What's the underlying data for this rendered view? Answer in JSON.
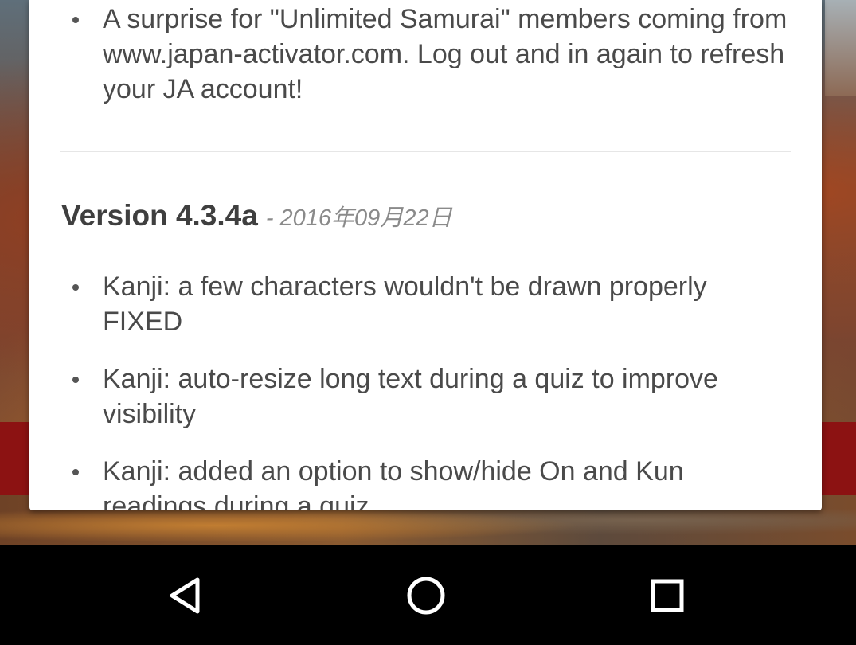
{
  "dialog": {
    "top_list": [
      {
        "text": "A surprise for \"Unlimited Samurai\" members coming from www.japan-activator.com. Log out and in again to refresh your JA account!"
      }
    ],
    "version": {
      "title": "Version 4.3.4a",
      "date": "- 2016年09月22日"
    },
    "changes": [
      {
        "text": "Kanji: a few characters wouldn't be drawn properly FIXED"
      },
      {
        "text": "Kanji: auto-resize long text during a quiz to improve visibility"
      },
      {
        "text": "Kanji: added an option to show/hide On and Kun readings during a quiz"
      }
    ]
  },
  "nav_bar": {
    "buttons": [
      {
        "icon": "back-triangle-icon"
      },
      {
        "icon": "home-circle-icon"
      },
      {
        "icon": "recents-square-icon"
      }
    ]
  },
  "colors": {
    "dialog_bg": "#ffffff",
    "text": "#4a4a4a",
    "date_text": "#8a8a8a",
    "nav_bar_bg": "#000000",
    "nav_icon": "#ffffff",
    "background_red_band": "#8c1212"
  }
}
